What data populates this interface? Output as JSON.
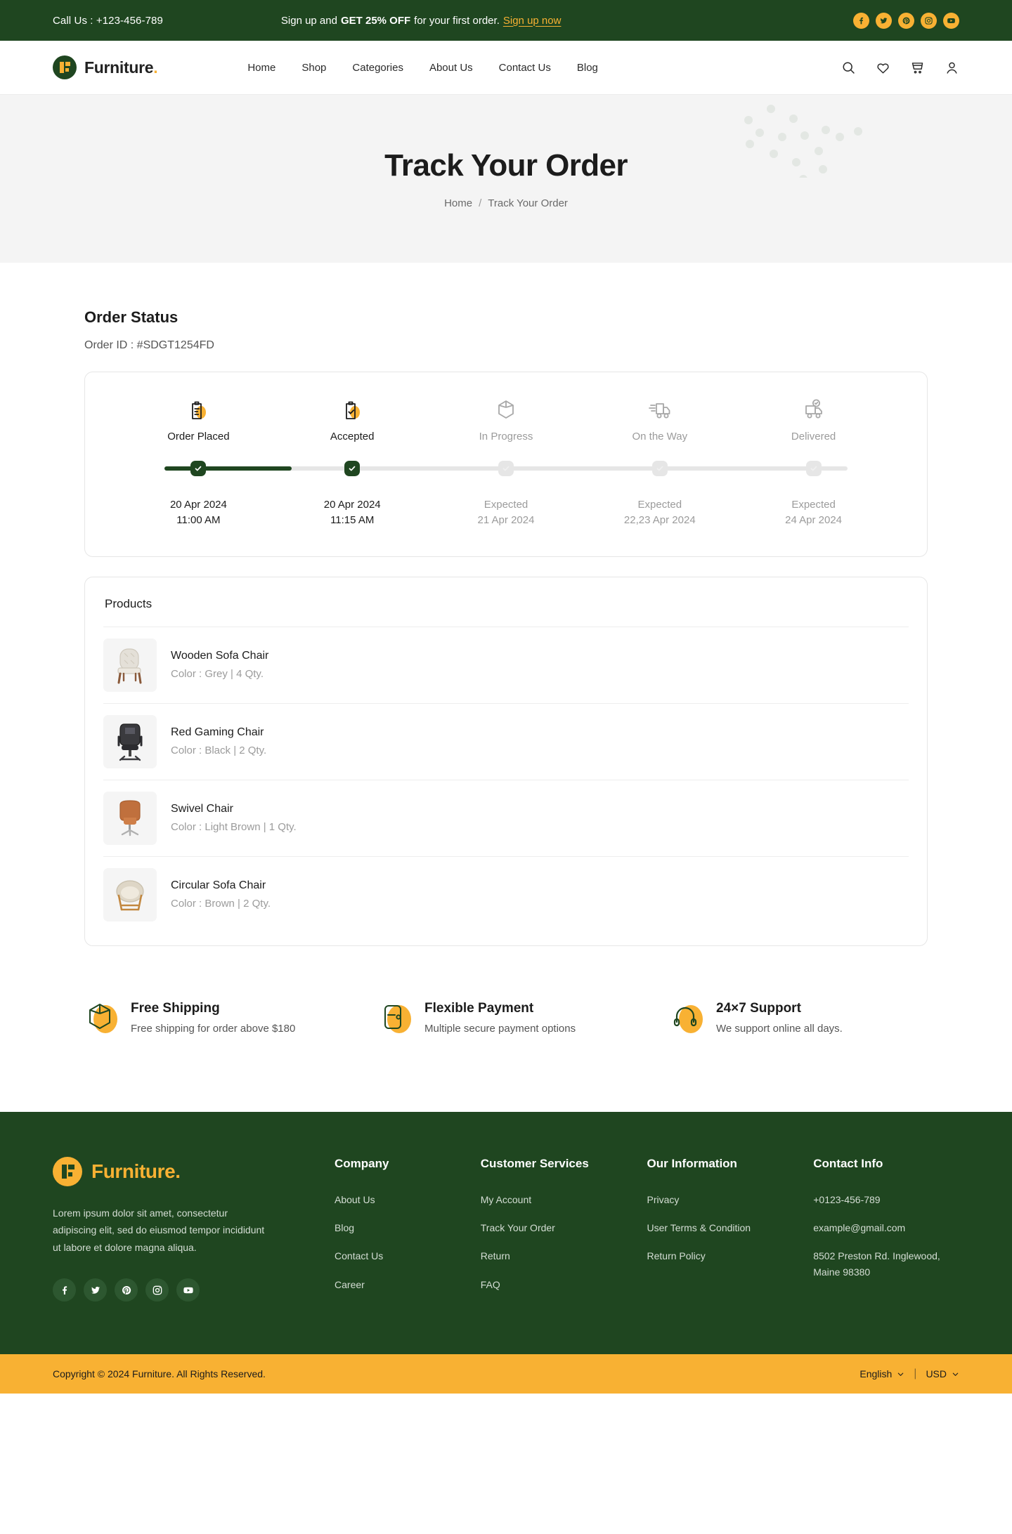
{
  "topbar": {
    "call_label": "Call Us :",
    "phone": "+123-456-789",
    "promo_prefix": "Sign up and",
    "promo_strong": "GET 25% OFF",
    "promo_suffix": "for your first order.",
    "signup_link": "Sign up now",
    "socials": [
      "facebook-icon",
      "twitter-icon",
      "pinterest-icon",
      "instagram-icon",
      "youtube-icon"
    ]
  },
  "header": {
    "brand_name": "Furniture",
    "brand_dot": ".",
    "nav": [
      {
        "label": "Home"
      },
      {
        "label": "Shop"
      },
      {
        "label": "Categories"
      },
      {
        "label": "About Us"
      },
      {
        "label": "Contact Us"
      },
      {
        "label": "Blog"
      }
    ],
    "icons": [
      "search-icon",
      "wishlist-heart-icon",
      "cart-icon",
      "account-user-icon"
    ]
  },
  "hero": {
    "title": "Track Your Order",
    "breadcrumb_home": "Home",
    "breadcrumb_sep": "/",
    "breadcrumb_current": "Track Your Order"
  },
  "order": {
    "section_title": "Order Status",
    "order_id_label": "Order ID : #SDGT1254FD",
    "steps": [
      {
        "label": "Order Placed",
        "icon": "clipboard-list-icon",
        "state": "done",
        "date_top": "20 Apr 2024",
        "date_bottom": "11:00 AM"
      },
      {
        "label": "Accepted",
        "icon": "clipboard-check-icon",
        "state": "done",
        "date_top": "20 Apr 2024",
        "date_bottom": "11:15 AM"
      },
      {
        "label": "In Progress",
        "icon": "package-box-icon",
        "state": "pending",
        "date_top": "Expected",
        "date_bottom": "21 Apr 2024"
      },
      {
        "label": "On the Way",
        "icon": "truck-fast-icon",
        "state": "pending",
        "date_top": "Expected",
        "date_bottom": "22,23 Apr 2024"
      },
      {
        "label": "Delivered",
        "icon": "truck-check-icon",
        "state": "pending",
        "date_top": "Expected",
        "date_bottom": "24 Apr 2024"
      }
    ]
  },
  "products": {
    "title": "Products",
    "items": [
      {
        "name": "Wooden Sofa Chair",
        "meta": "Color : Grey | 4 Qty.",
        "thumb": "wooden-sofa-chair-image"
      },
      {
        "name": "Red Gaming Chair",
        "meta": "Color : Black | 2 Qty.",
        "thumb": "red-gaming-chair-image"
      },
      {
        "name": "Swivel Chair",
        "meta": "Color : Light Brown | 1 Qty.",
        "thumb": "swivel-chair-image"
      },
      {
        "name": "Circular Sofa Chair",
        "meta": "Color :  Brown | 2 Qty.",
        "thumb": "circular-sofa-chair-image"
      }
    ]
  },
  "features": [
    {
      "icon": "shipping-box-icon",
      "title": "Free Shipping",
      "sub": "Free shipping for order above $180"
    },
    {
      "icon": "wallet-card-icon",
      "title": "Flexible Payment",
      "sub": "Multiple secure payment options"
    },
    {
      "icon": "headset-icon",
      "title": "24×7 Support",
      "sub": "We support online all days."
    }
  ],
  "footer": {
    "brand_name": "Furniture",
    "brand_dot": ".",
    "description": "Lorem ipsum dolor sit amet, consectetur adipiscing elit, sed do eiusmod tempor incididunt ut labore et dolore magna aliqua.",
    "socials": [
      "facebook-icon",
      "twitter-icon",
      "pinterest-icon",
      "instagram-icon",
      "youtube-icon"
    ],
    "columns": [
      {
        "heading": "Company",
        "links": [
          "About Us",
          "Blog",
          "Contact Us",
          "Career"
        ]
      },
      {
        "heading": "Customer Services",
        "links": [
          "My Account",
          "Track Your Order",
          "Return",
          "FAQ"
        ]
      },
      {
        "heading": "Our Information",
        "links": [
          "Privacy",
          "User Terms & Condition",
          "Return Policy"
        ]
      }
    ],
    "contact": {
      "heading": "Contact Info",
      "phone": "+0123-456-789",
      "email": "example@gmail.com",
      "address": "8502 Preston Rd. Inglewood, Maine 98380"
    }
  },
  "copybar": {
    "text": "Copyright © 2024 Furniture. All Rights Reserved.",
    "language": "English",
    "currency": "USD"
  },
  "colors": {
    "green": "#1f4620",
    "yellow": "#f8b133",
    "muted": "#9b9b9b",
    "hero_bg": "#f4f4f4"
  }
}
